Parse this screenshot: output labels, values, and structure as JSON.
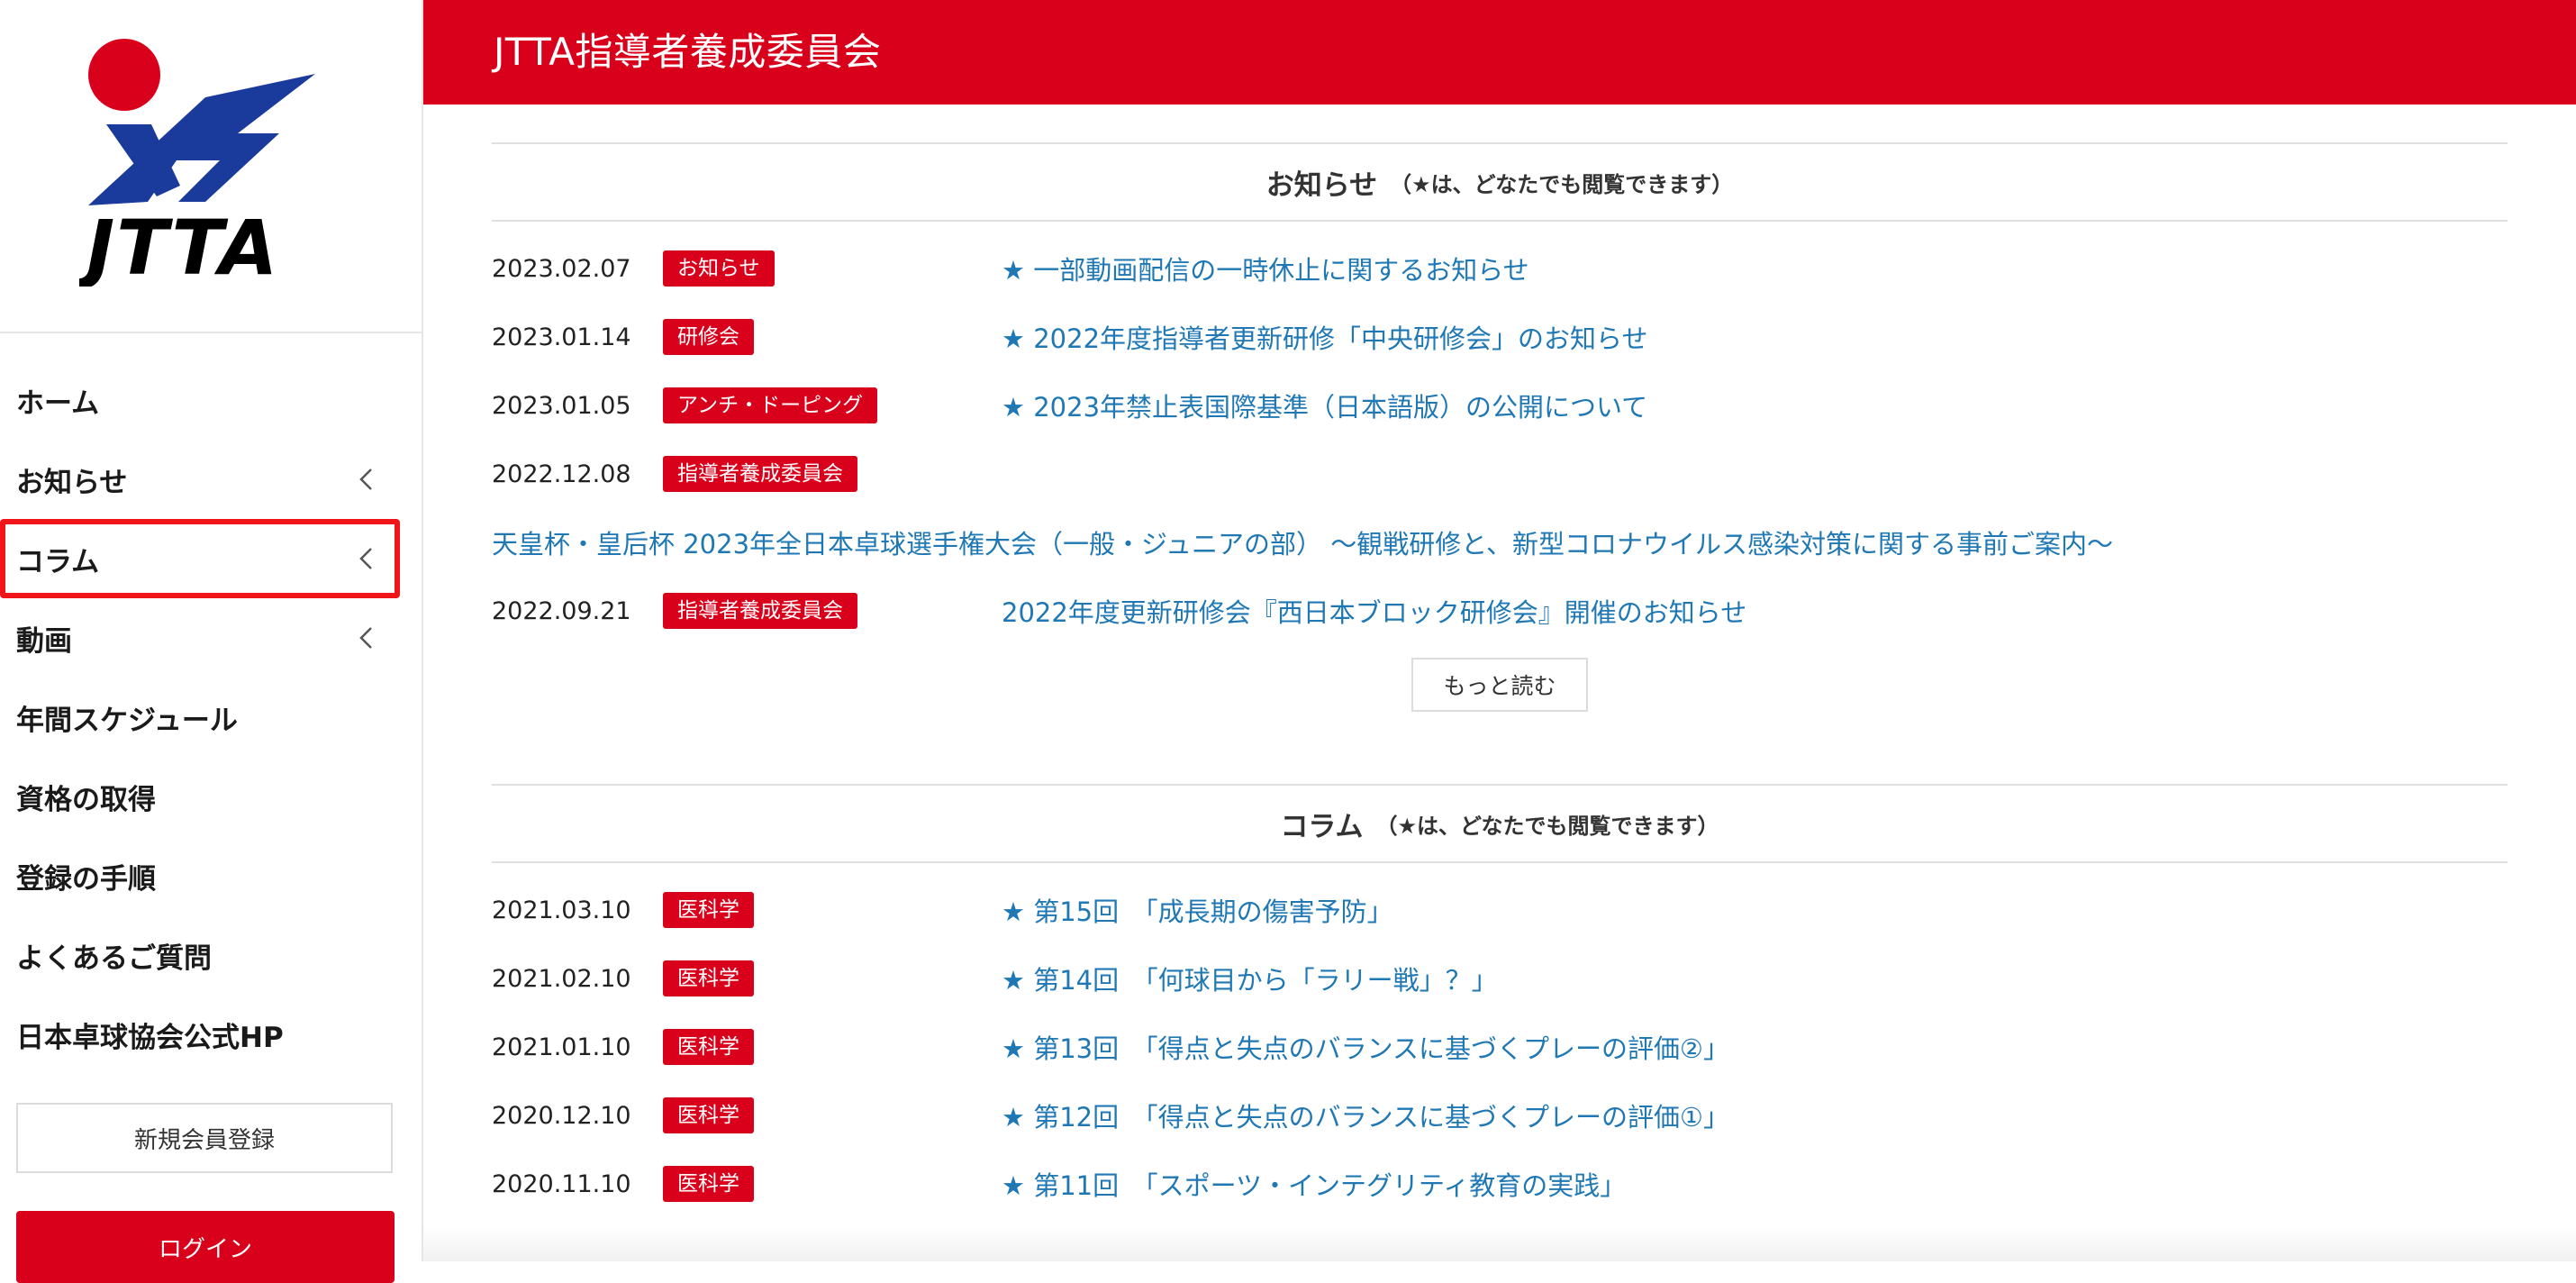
{
  "sidebar": {
    "logo_text": "JTTA",
    "items": [
      {
        "label": "ホーム",
        "chevron": false
      },
      {
        "label": "お知らせ",
        "chevron": true
      },
      {
        "label": "コラム",
        "chevron": true,
        "highlighted": true
      },
      {
        "label": "動画",
        "chevron": true
      },
      {
        "label": "年間スケジュール",
        "chevron": false
      },
      {
        "label": "資格の取得",
        "chevron": false
      },
      {
        "label": "登録の手順",
        "chevron": false
      },
      {
        "label": "よくあるご質問",
        "chevron": false
      },
      {
        "label": "日本卓球協会公式HP",
        "chevron": false
      }
    ],
    "register_label": "新規会員登録",
    "login_label": "ログイン"
  },
  "header": {
    "title": "JTTA指導者養成委員会"
  },
  "news": {
    "title": "お知らせ",
    "note": "（★は、どなたでも閲覧できます）",
    "rows": [
      {
        "date": "2023.02.07",
        "tag": "お知らせ",
        "title": "★ 一部動画配信の一時休止に関するお知らせ"
      },
      {
        "date": "2023.01.14",
        "tag": "研修会",
        "title": "★ 2022年度指導者更新研修「中央研修会」のお知らせ"
      },
      {
        "date": "2023.01.05",
        "tag": "アンチ・ドーピング",
        "title": "★ 2023年禁止表国際基準（日本語版）の公開について"
      },
      {
        "date": "2022.12.08",
        "tag": "指導者養成委員会",
        "title": ""
      }
    ],
    "wrapped_title": "天皇杯・皇后杯 2023年全日本卓球選手権大会（一般・ジュニアの部） 〜観戦研修と、新型コロナウイルス感染対策に関する事前ご案内〜",
    "rows2": [
      {
        "date": "2022.09.21",
        "tag": "指導者養成委員会",
        "title": "2022年度更新研修会『西日本ブロック研修会』開催のお知らせ"
      }
    ],
    "more_label": "もっと読む"
  },
  "column": {
    "title": "コラム",
    "note": "（★は、どなたでも閲覧できます）",
    "rows": [
      {
        "date": "2021.03.10",
        "tag": "医科学",
        "title": "★ 第15回　「成長期の傷害予防」"
      },
      {
        "date": "2021.02.10",
        "tag": "医科学",
        "title": "★ 第14回　「何球目から「ラリー戦」？」"
      },
      {
        "date": "2021.01.10",
        "tag": "医科学",
        "title": "★ 第13回　「得点と失点のバランスに基づくプレーの評価②」"
      },
      {
        "date": "2020.12.10",
        "tag": "医科学",
        "title": "★ 第12回　「得点と失点のバランスに基づくプレーの評価①」"
      },
      {
        "date": "2020.11.10",
        "tag": "医科学",
        "title": "★ 第11回　「スポーツ・インテグリティ教育の実践」"
      }
    ]
  },
  "colors": {
    "brand_red": "#d9001b",
    "link_blue": "#1f78b4",
    "logo_blue": "#1a3a9c"
  }
}
